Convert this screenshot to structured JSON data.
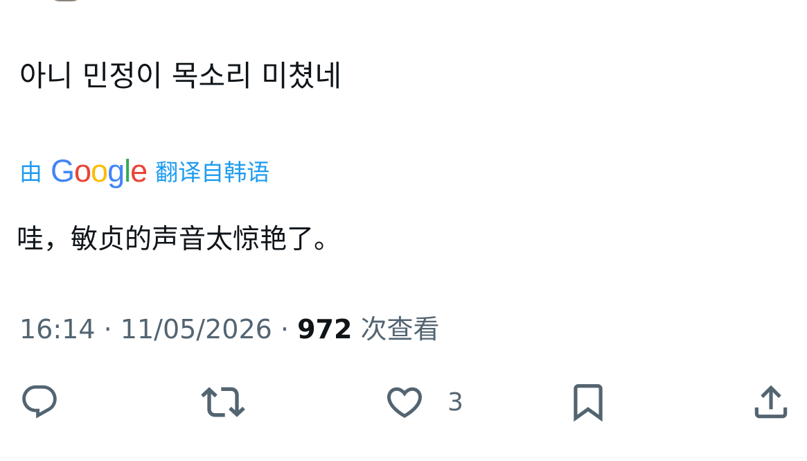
{
  "tweet": {
    "text": "아니 민정이 목소리 미쳤네"
  },
  "translation": {
    "prefix": "由",
    "provider_logo": {
      "letters": [
        "G",
        "o",
        "o",
        "g",
        "l",
        "e"
      ],
      "colors": [
        "#4285F4",
        "#EA4335",
        "#FBBC05",
        "#4285F4",
        "#34A853",
        "#EA4335"
      ]
    },
    "suffix": "翻译自韩语",
    "text": "哇，敏贞的声音太惊艳了。",
    "link_color": "#1d9bf0"
  },
  "meta": {
    "time": "16:14",
    "separator": "·",
    "date": "11/05/2026",
    "views_count": "972",
    "views_label": "次查看"
  },
  "actions": {
    "reply_icon": "reply-icon",
    "retweet_icon": "retweet-icon",
    "like_icon": "heart-icon",
    "like_count": "3",
    "bookmark_icon": "bookmark-icon",
    "share_icon": "share-icon",
    "icon_color": "#536471"
  }
}
